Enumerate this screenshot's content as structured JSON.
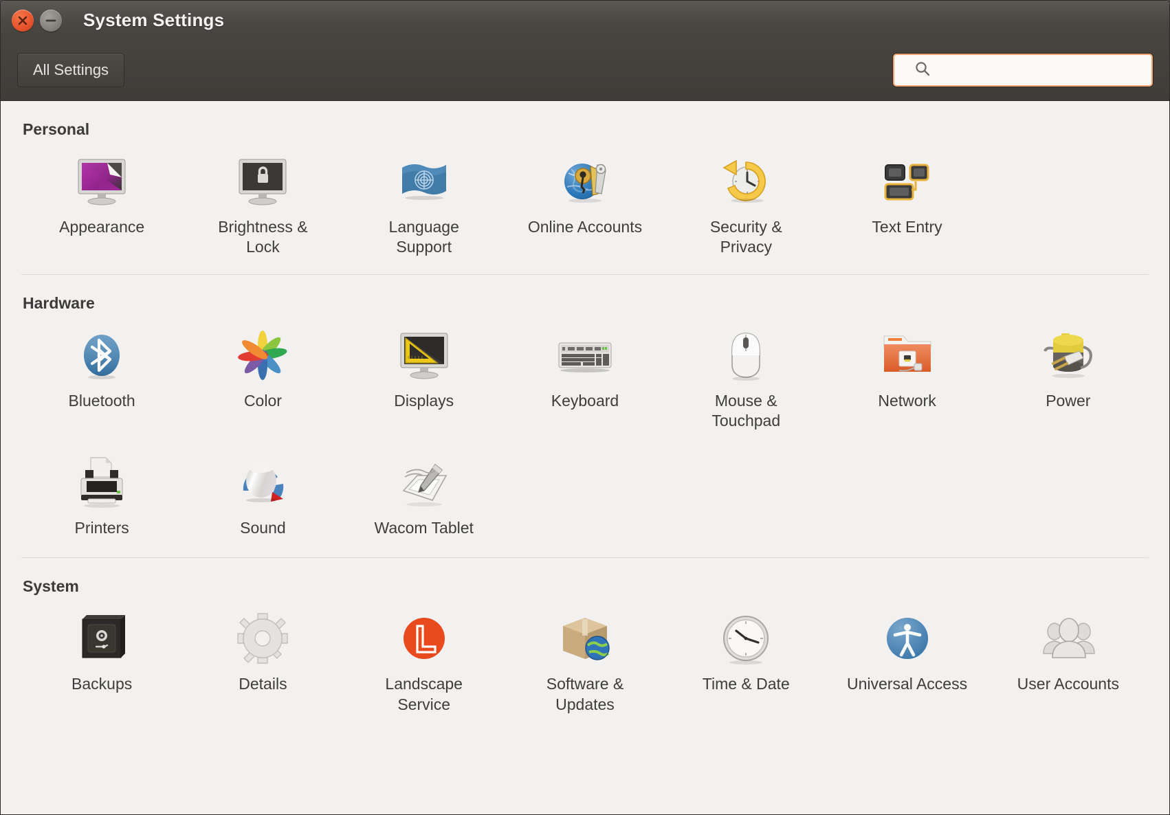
{
  "window": {
    "title": "System Settings",
    "close_button": "close-icon",
    "minimize_button": "minimize-icon"
  },
  "toolbar": {
    "all_settings_label": "All Settings",
    "search_placeholder": "",
    "search_value": "",
    "search_icon": "search-icon"
  },
  "colors": {
    "titlebar": "#4b4844",
    "toolbar": "#443f3b",
    "content_bg": "#f2f1f0",
    "close_button": "#e8552d",
    "minimize_button": "#88857f",
    "search_focus_border": "#f0a571",
    "section_title": "#3c3b39",
    "label_text": "#3e3d3b"
  },
  "sections": [
    {
      "title": "Personal",
      "items": [
        {
          "label": "Appearance",
          "icon": "appearance-icon"
        },
        {
          "label": "Brightness & Lock",
          "icon": "brightness-lock-icon"
        },
        {
          "label": "Language Support",
          "icon": "language-support-icon"
        },
        {
          "label": "Online Accounts",
          "icon": "online-accounts-icon"
        },
        {
          "label": "Security & Privacy",
          "icon": "security-privacy-icon"
        },
        {
          "label": "Text Entry",
          "icon": "text-entry-icon"
        }
      ]
    },
    {
      "title": "Hardware",
      "items": [
        {
          "label": "Bluetooth",
          "icon": "bluetooth-icon"
        },
        {
          "label": "Color",
          "icon": "color-icon"
        },
        {
          "label": "Displays",
          "icon": "displays-icon"
        },
        {
          "label": "Keyboard",
          "icon": "keyboard-icon"
        },
        {
          "label": "Mouse & Touchpad",
          "icon": "mouse-touchpad-icon"
        },
        {
          "label": "Network",
          "icon": "network-icon"
        },
        {
          "label": "Power",
          "icon": "power-icon"
        },
        {
          "label": "Printers",
          "icon": "printers-icon"
        },
        {
          "label": "Sound",
          "icon": "sound-icon"
        },
        {
          "label": "Wacom Tablet",
          "icon": "wacom-tablet-icon"
        }
      ]
    },
    {
      "title": "System",
      "items": [
        {
          "label": "Backups",
          "icon": "backups-icon"
        },
        {
          "label": "Details",
          "icon": "details-icon"
        },
        {
          "label": "Landscape Service",
          "icon": "landscape-service-icon"
        },
        {
          "label": "Software & Updates",
          "icon": "software-updates-icon"
        },
        {
          "label": "Time & Date",
          "icon": "time-date-icon"
        },
        {
          "label": "Universal Access",
          "icon": "universal-access-icon"
        },
        {
          "label": "User Accounts",
          "icon": "user-accounts-icon"
        }
      ]
    }
  ]
}
